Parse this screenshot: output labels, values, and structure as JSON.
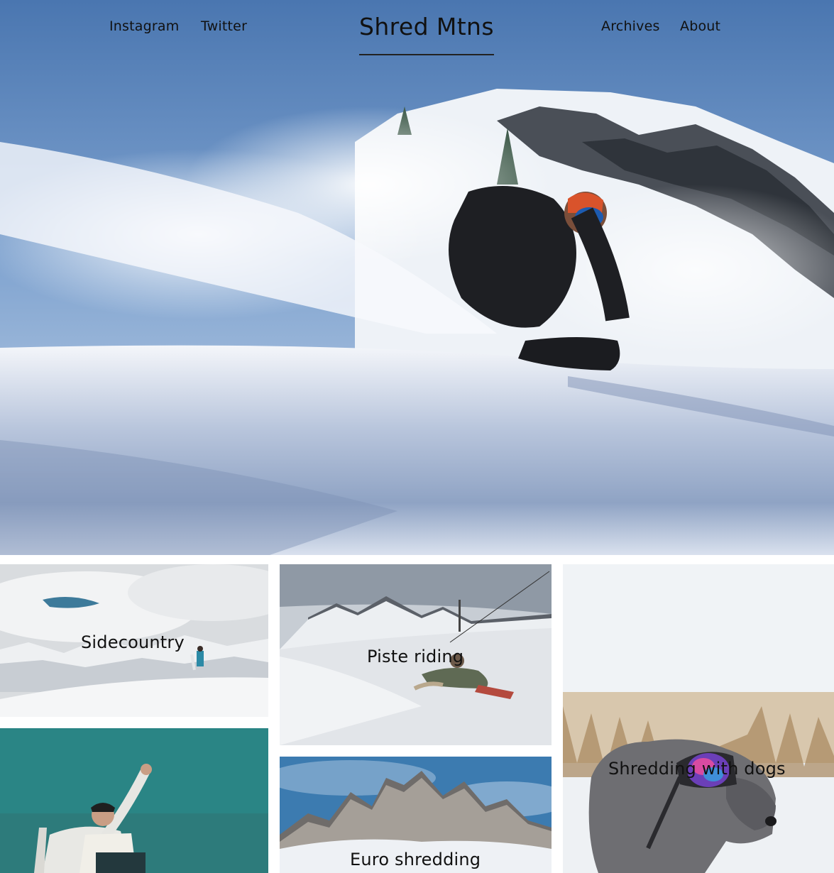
{
  "header": {
    "brand": "Shred Mtns",
    "left_links": [
      "Instagram",
      "Twitter"
    ],
    "right_links": [
      "Archives",
      "About"
    ]
  },
  "hero": {
    "image": "snowboarder-powder-turn-photo"
  },
  "tiles": [
    {
      "label": "Sidecountry",
      "image": "snowboarder-on-ridge-photo"
    },
    {
      "label": "Piste riding",
      "image": "snowboarder-carving-piste-photo"
    },
    {
      "label": "Shredding with dogs",
      "image": "dog-wearing-goggles-photo"
    },
    {
      "label": "",
      "image": "rider-holding-snowboard-photo"
    },
    {
      "label": "Euro shredding",
      "image": "dolomites-peaks-photo"
    }
  ],
  "colors": {
    "text": "#111111",
    "background": "#ffffff",
    "sky": "#4f7ab3"
  }
}
